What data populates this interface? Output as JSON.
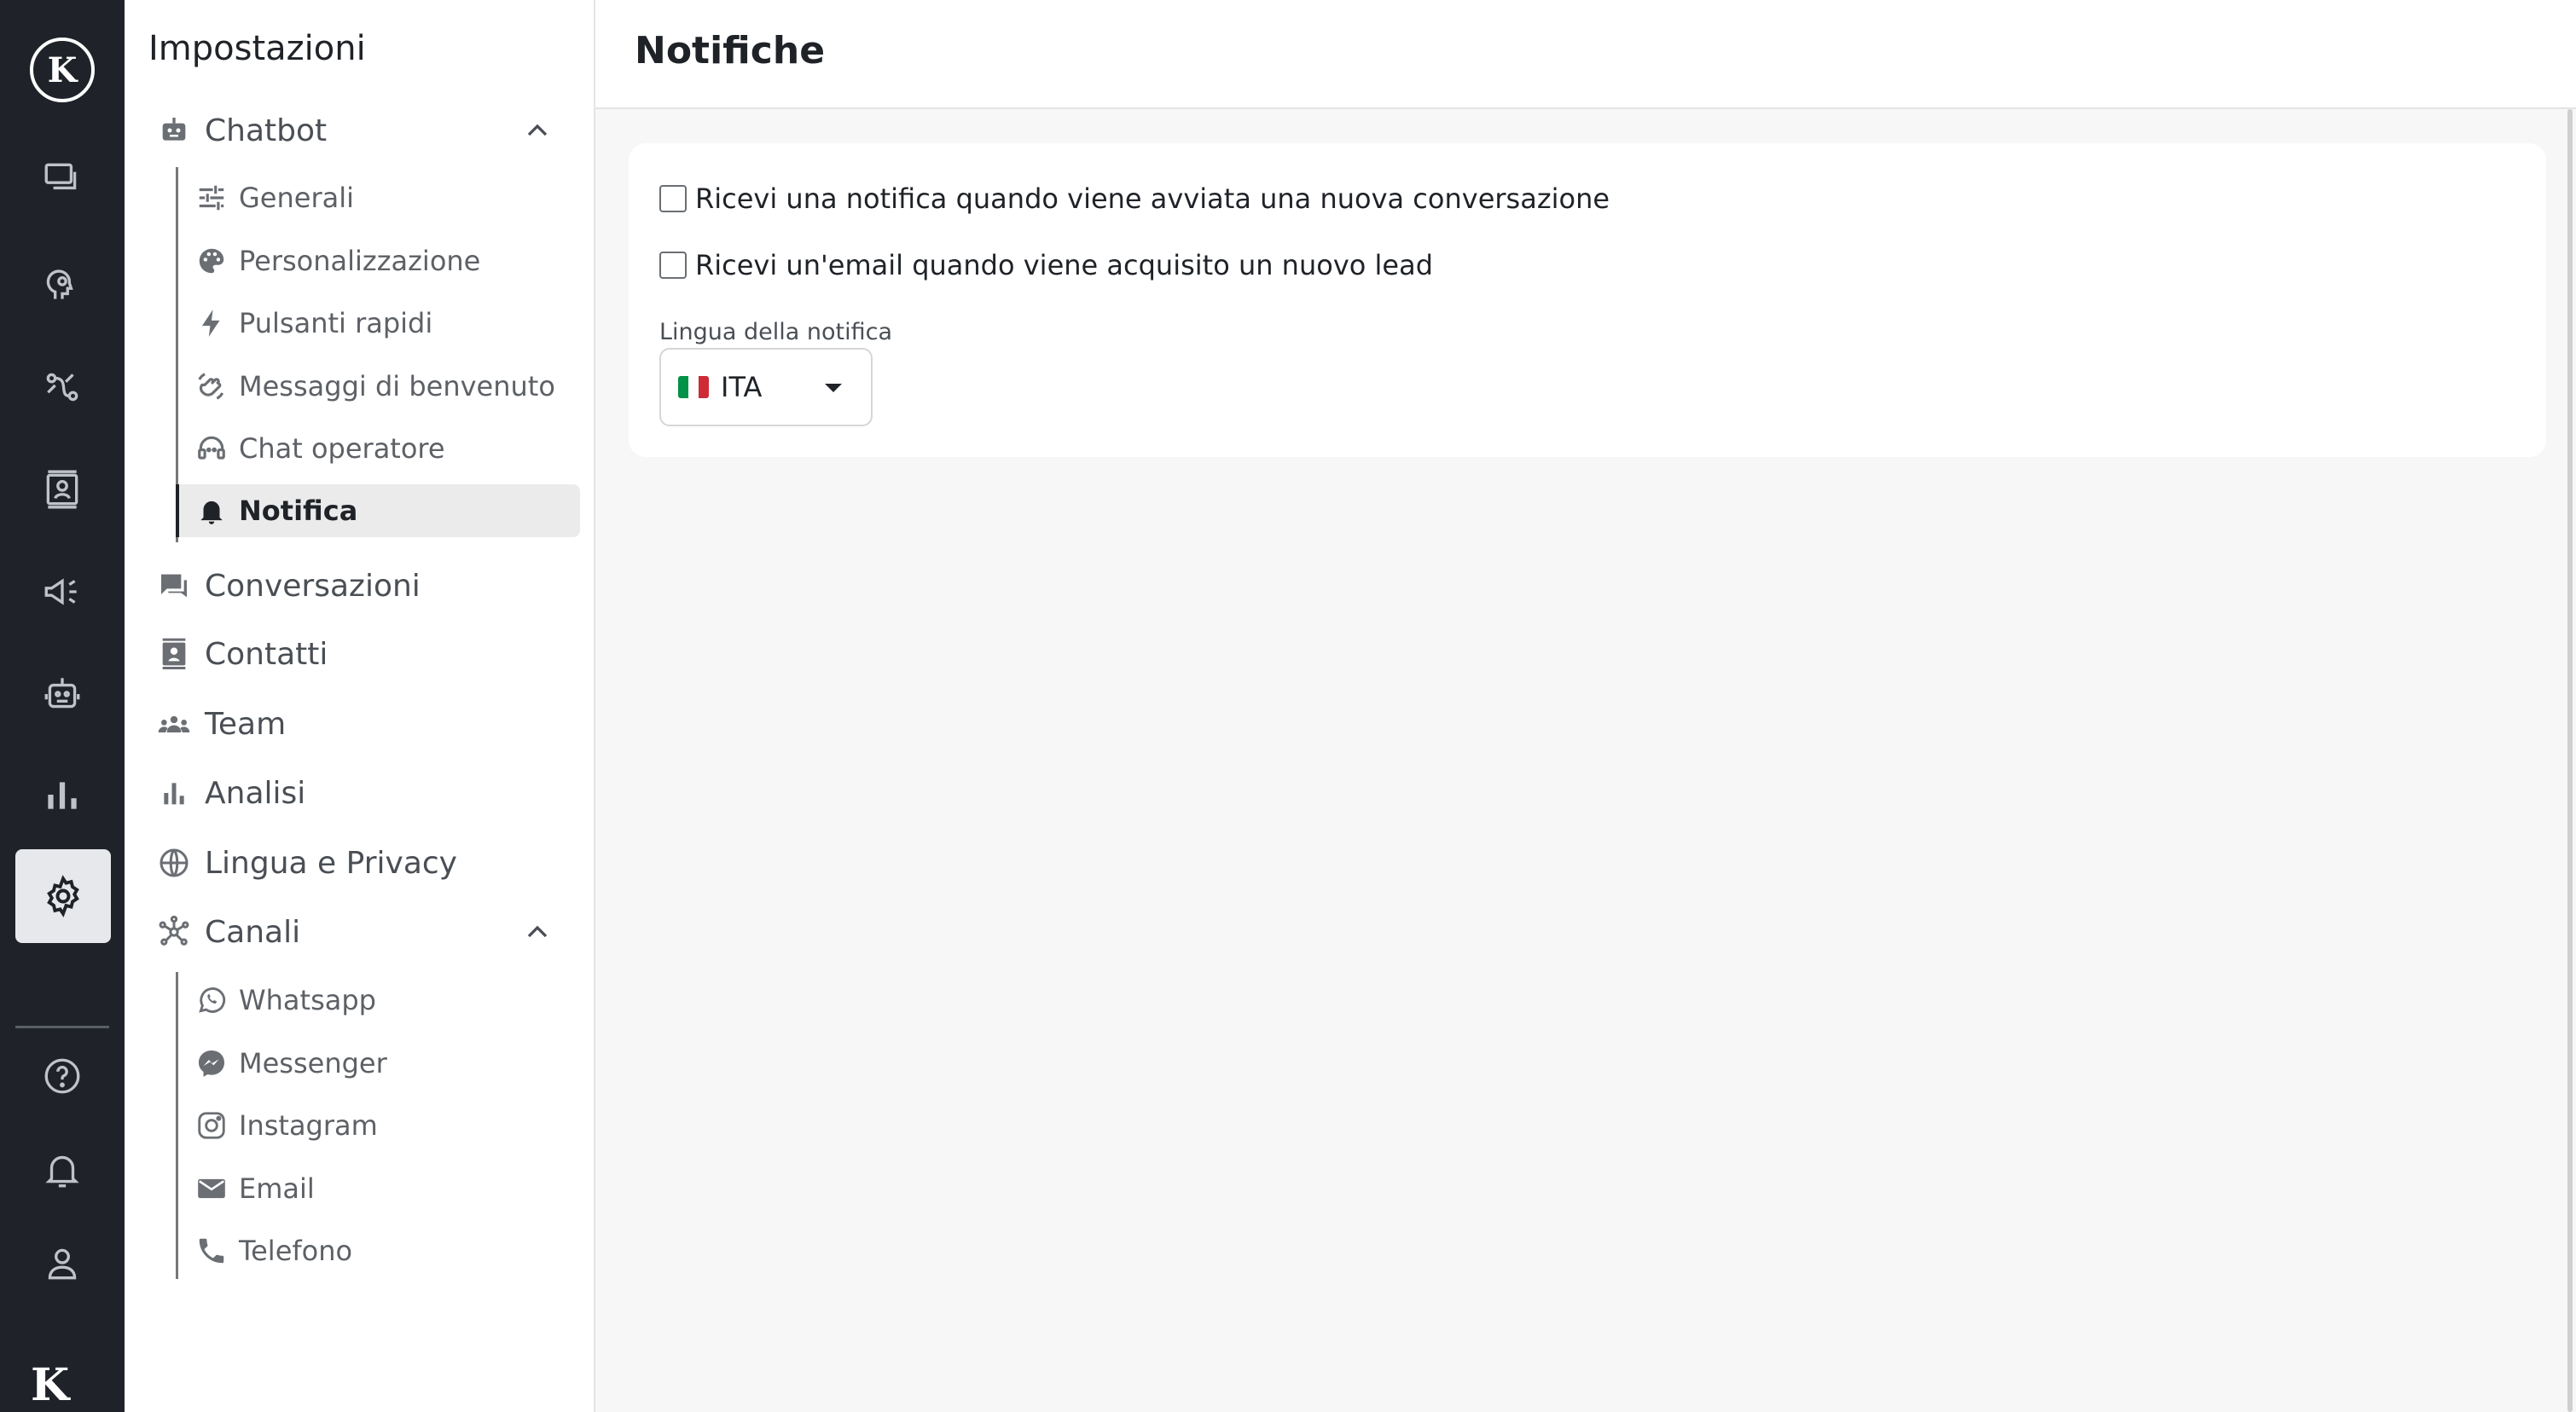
{
  "rail": {
    "logo_letter": "K",
    "bottom_logo": "K"
  },
  "sidebar": {
    "title": "Impostazioni",
    "chatbot_label": "Chatbot",
    "chatbot_items": [
      {
        "label": "Generali",
        "icon": "tune-icon"
      },
      {
        "label": "Personalizzazione",
        "icon": "palette-icon"
      },
      {
        "label": "Pulsanti rapidi",
        "icon": "bolt-icon"
      },
      {
        "label": "Messaggi di benvenuto",
        "icon": "wave-icon"
      },
      {
        "label": "Chat operatore",
        "icon": "headset-icon"
      },
      {
        "label": "Notifica",
        "icon": "bell-icon",
        "active": true
      }
    ],
    "conversazioni_label": "Conversazioni",
    "contatti_label": "Contatti",
    "team_label": "Team",
    "analisi_label": "Analisi",
    "lingua_label": "Lingua e Privacy",
    "canali_label": "Canali",
    "canali_items": [
      {
        "label": "Whatsapp",
        "icon": "whatsapp-icon"
      },
      {
        "label": "Messenger",
        "icon": "messenger-icon"
      },
      {
        "label": "Instagram",
        "icon": "instagram-icon"
      },
      {
        "label": "Email",
        "icon": "email-icon"
      },
      {
        "label": "Telefono",
        "icon": "phone-icon"
      }
    ]
  },
  "main": {
    "title": "Notifiche",
    "check_new_conversation": "Ricevi una notifica quando viene avviata una nuova conversazione",
    "check_new_lead": "Ricevi un'email quando viene acquisito un nuovo lead",
    "language_label": "Lingua della notifica",
    "language_value": "ITA"
  },
  "colors": {
    "rail_bg": "#1f2329",
    "accent": "#1f2328",
    "flag_green": "#009246",
    "flag_white": "#ffffff",
    "flag_red": "#ce2b37"
  }
}
